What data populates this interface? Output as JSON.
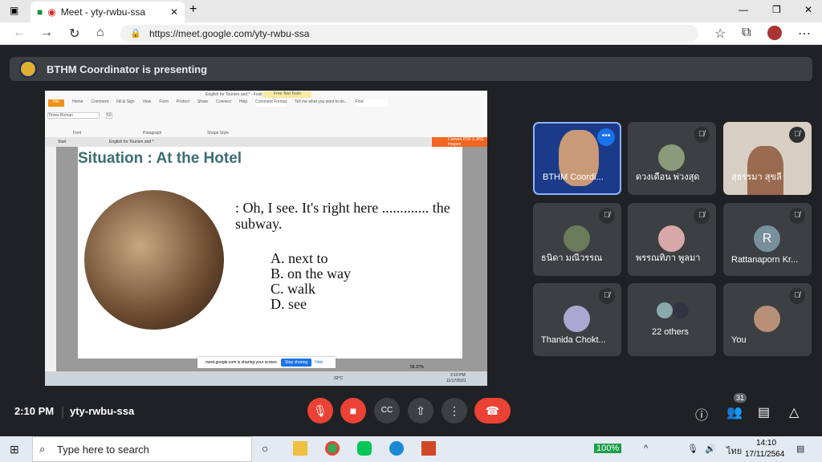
{
  "browser": {
    "tab_title": "Meet - yty-rwbu-ssa",
    "url": "https://meet.google.com/yty-rwbu-ssa"
  },
  "meet": {
    "presenting": "BTHM Coordinator is presenting",
    "time": "2:10 PM",
    "code": "yty-rwbu-ssa",
    "participants_count": "31"
  },
  "shared": {
    "app_title": "English for Tourism and * - Foxit Reader",
    "free_text_tools": "Free Text Tools",
    "menu": [
      "File",
      "Home",
      "Comment",
      "Fill & Sign",
      "View",
      "Form",
      "Protect",
      "Share",
      "Connect",
      "Help",
      "Comment Format"
    ],
    "tell_me": "Tell me what you want to do...",
    "find": "Find",
    "font": "Times Roman",
    "font_size": "50",
    "groups": [
      "Font",
      "Paragraph",
      "Shape Style"
    ],
    "doc_tabs": [
      "Start",
      "English for Tourism and *"
    ],
    "convert": "Convert PDF 2 JPG images",
    "slide_title": "Situation : At the Hotel",
    "question": ": Oh, I see. It's right here ............. the subway.",
    "options": [
      "A. next to",
      "B. on the way",
      "C. walk",
      "D. see"
    ],
    "sharing_text": "meet.google.com is sharing your screen.",
    "stop_sharing": "Stop sharing",
    "hide": "Hide",
    "zoom": "58.37%",
    "weather": "32°C",
    "clock_time": "2:10 PM",
    "clock_date": "11/17/2021"
  },
  "tiles": [
    {
      "name": "BTHM Coordi...",
      "muted": false,
      "video": true
    },
    {
      "name": "ดวงเดือน พ่วงสุด",
      "muted": true
    },
    {
      "name": "สุธรรมา สุขลี",
      "muted": true,
      "video": true
    },
    {
      "name": "ธนิดา มณีวรรณ",
      "muted": true
    },
    {
      "name": "พรรณทิภา พูลมา",
      "muted": true
    },
    {
      "name": "Rattanaporn Kr...",
      "muted": true,
      "initial": "R"
    },
    {
      "name": "Thanida Chokt...",
      "muted": true
    },
    {
      "name": "22 others",
      "muted": false
    },
    {
      "name": "You",
      "muted": true
    }
  ],
  "taskbar": {
    "search_placeholder": "Type here to search",
    "battery": "100%",
    "lang": "ไทย",
    "time": "14:10",
    "date": "17/11/2564"
  },
  "colors": {
    "meet_bg": "#202124",
    "end_call": "#ea4335",
    "accent": "#1a73e8"
  }
}
